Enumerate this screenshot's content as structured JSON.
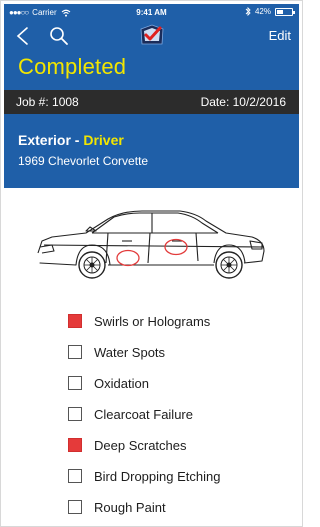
{
  "statusbar": {
    "carrier": "Carrier",
    "signal_dots": "●●●○○",
    "time": "9:41 AM",
    "battery": "42%",
    "battery_fraction": 0.42
  },
  "nav": {
    "back_icon": "chevron-left-icon",
    "search_icon": "search-icon",
    "logo_icon": "checkmark-badge-icon",
    "edit_label": "Edit"
  },
  "status": {
    "title": "Completed"
  },
  "job": {
    "number": "Job #: 1008",
    "date": "Date: 10/2/2016"
  },
  "section": {
    "area": "Exterior -",
    "side": "Driver",
    "vehicle": "1969 Chevorlet Corvette"
  },
  "colors": {
    "header_blue": "#1f5fa8",
    "accent_yellow": "#f2e600",
    "job_bar": "#2c2c2c",
    "checked_red": "#e53a3a",
    "damage_circle": "#e23b3b"
  },
  "checklist": [
    {
      "label": "Swirls or Holograms",
      "checked": true
    },
    {
      "label": "Water Spots",
      "checked": false
    },
    {
      "label": "Oxidation",
      "checked": false
    },
    {
      "label": "Clearcoat Failure",
      "checked": false
    },
    {
      "label": "Deep Scratches",
      "checked": true
    },
    {
      "label": "Bird Dropping Etching",
      "checked": false
    },
    {
      "label": "Rough Paint",
      "checked": false
    }
  ]
}
